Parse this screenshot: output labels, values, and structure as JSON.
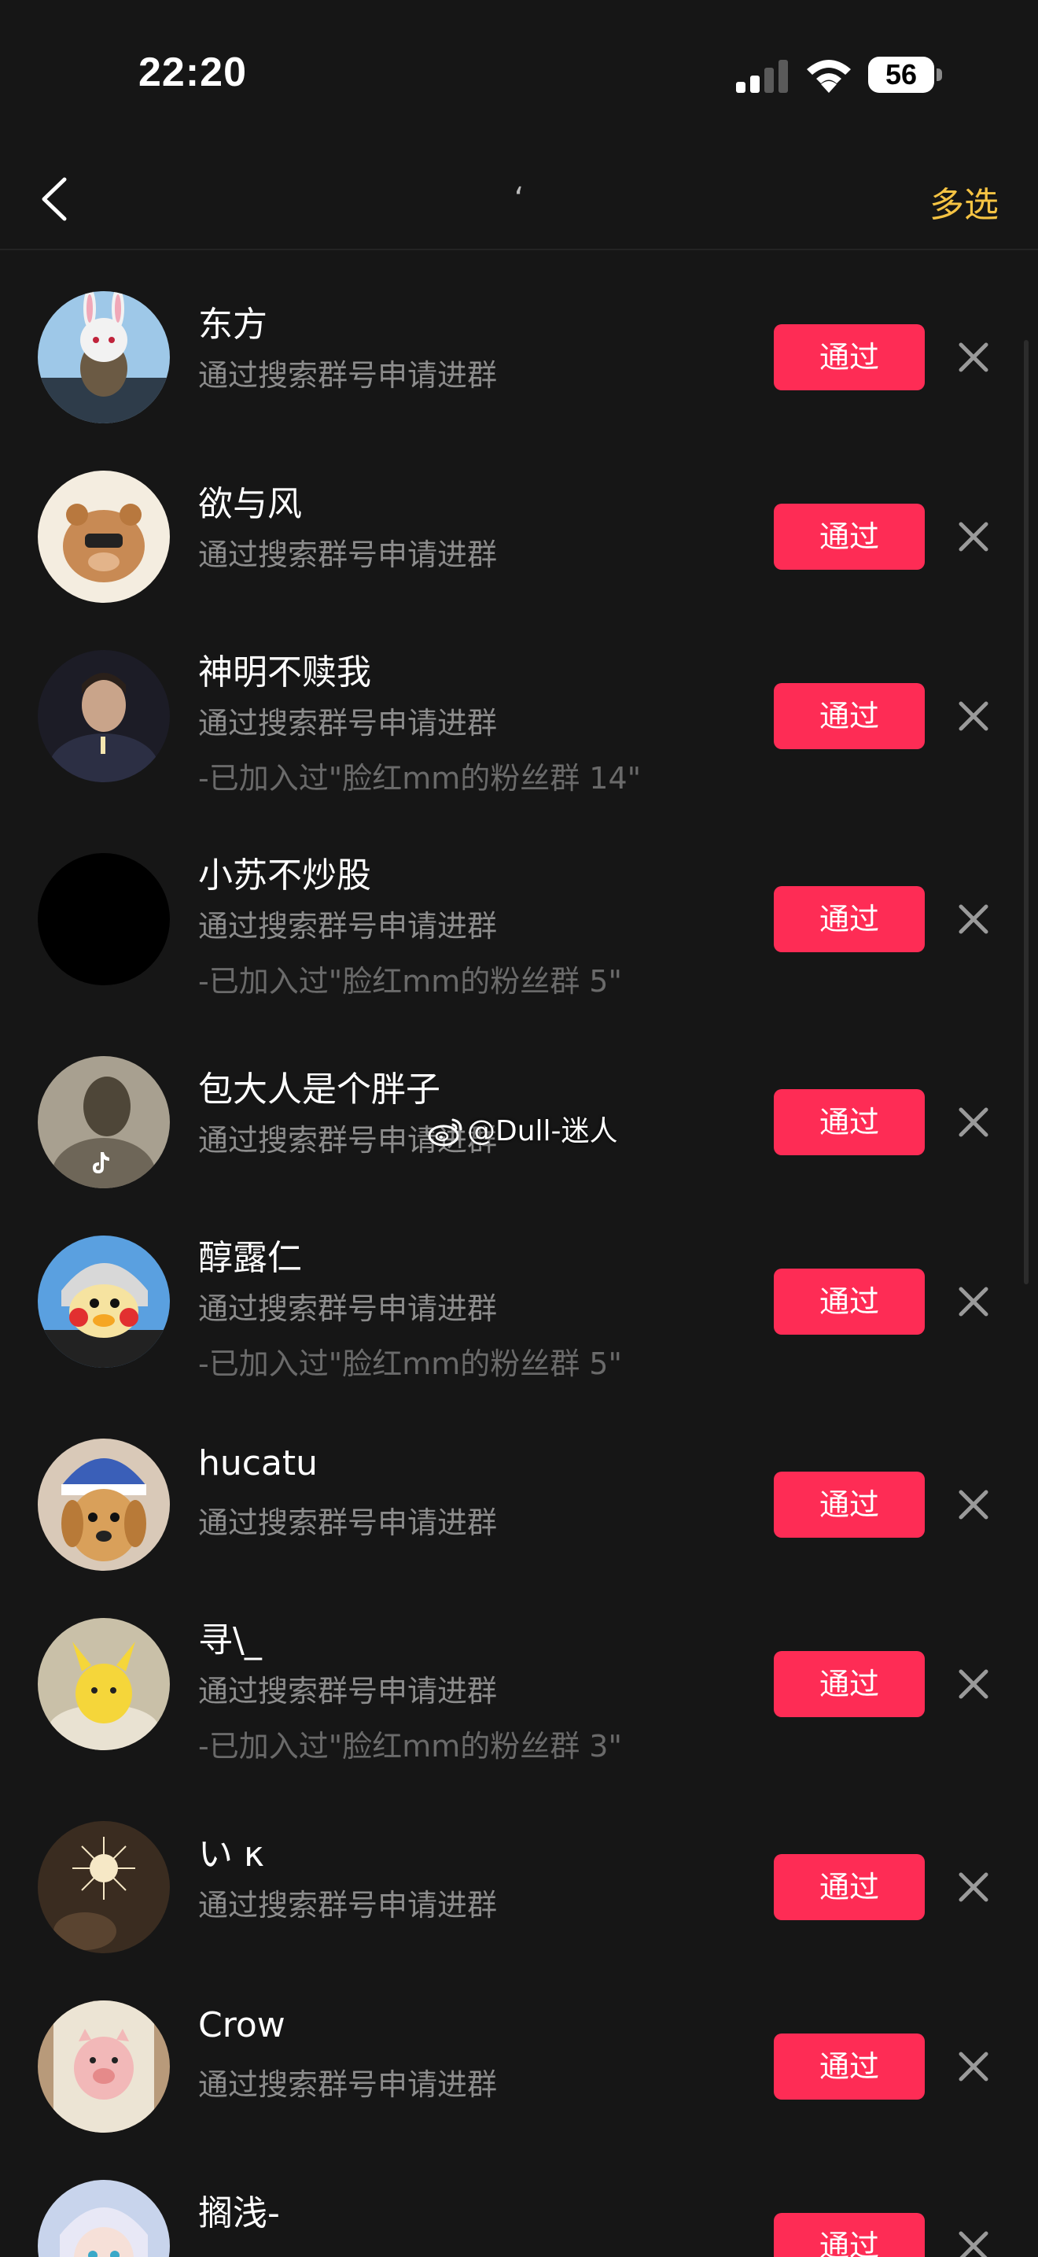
{
  "status_bar": {
    "time": "22:20",
    "battery": "56",
    "signal_icon": "cellular-signal-icon",
    "wifi_icon": "wifi-icon"
  },
  "nav": {
    "back_icon": "chevron-left-icon",
    "title": "‘",
    "multiselect_label": "多选",
    "accent_color": "#f5c343"
  },
  "colors": {
    "background": "#161616",
    "approve": "#fe2c55",
    "secondary_text": "#8c8c8c"
  },
  "approve_label": "通过",
  "reject_icon": "close-icon",
  "requests": [
    {
      "name": "东方",
      "source": "通过搜索群号申请进群",
      "note": ""
    },
    {
      "name": "欲与风",
      "source": "通过搜索群号申请进群",
      "note": ""
    },
    {
      "name": "神明不赎我",
      "source": "通过搜索群号申请进群",
      "note": "-已加入过\"脸红mm的粉丝群 14\""
    },
    {
      "name": "小苏不炒股",
      "source": "通过搜索群号申请进群",
      "note": "-已加入过\"脸红mm的粉丝群 5\""
    },
    {
      "name": "包大人是个胖子",
      "source": "通过搜索群号申请进群",
      "note": ""
    },
    {
      "name": "醇露仁",
      "source": "通过搜索群号申请进群",
      "note": "-已加入过\"脸红mm的粉丝群 5\""
    },
    {
      "name": "hucatu",
      "source": "通过搜索群号申请进群",
      "note": ""
    },
    {
      "name": "寻\\_",
      "source": "通过搜索群号申请进群",
      "note": "-已加入过\"脸红mm的粉丝群 3\""
    },
    {
      "name": "い κ",
      "source": "通过搜索群号申请进群",
      "note": ""
    },
    {
      "name": "Crow",
      "source": "通过搜索群号申请进群",
      "note": ""
    },
    {
      "name": "搁浅-",
      "source": "",
      "note": ""
    }
  ],
  "watermark": "@Dull-迷人",
  "watermark_icon": "weibo-icon"
}
